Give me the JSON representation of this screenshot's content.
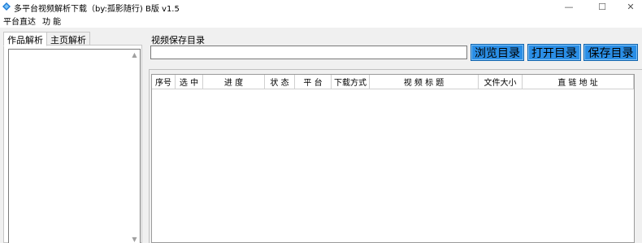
{
  "window": {
    "title": "多平台视频解析下载（by:孤影随行) B版 v1.5",
    "minimize_glyph": "—",
    "maximize_glyph": "☐",
    "close_glyph": "✕",
    "accent_color": "#2a8ee6"
  },
  "menu": {
    "items": [
      "平台直达",
      "功 能"
    ]
  },
  "left_panel": {
    "tabs": [
      "作品解析",
      "主页解析"
    ],
    "active_tab": "作品解析"
  },
  "save_dir": {
    "label": "视频保存目录",
    "value": "",
    "placeholder": ""
  },
  "buttons": {
    "browse": "浏览目录",
    "open": "打开目录",
    "save": "保存目录"
  },
  "table": {
    "columns": [
      "序号",
      "选 中",
      "进 度",
      "状 态",
      "平 台",
      "下载方式",
      "视 频 标 题",
      "文件大小",
      "直 链 地 址"
    ],
    "rows": []
  }
}
